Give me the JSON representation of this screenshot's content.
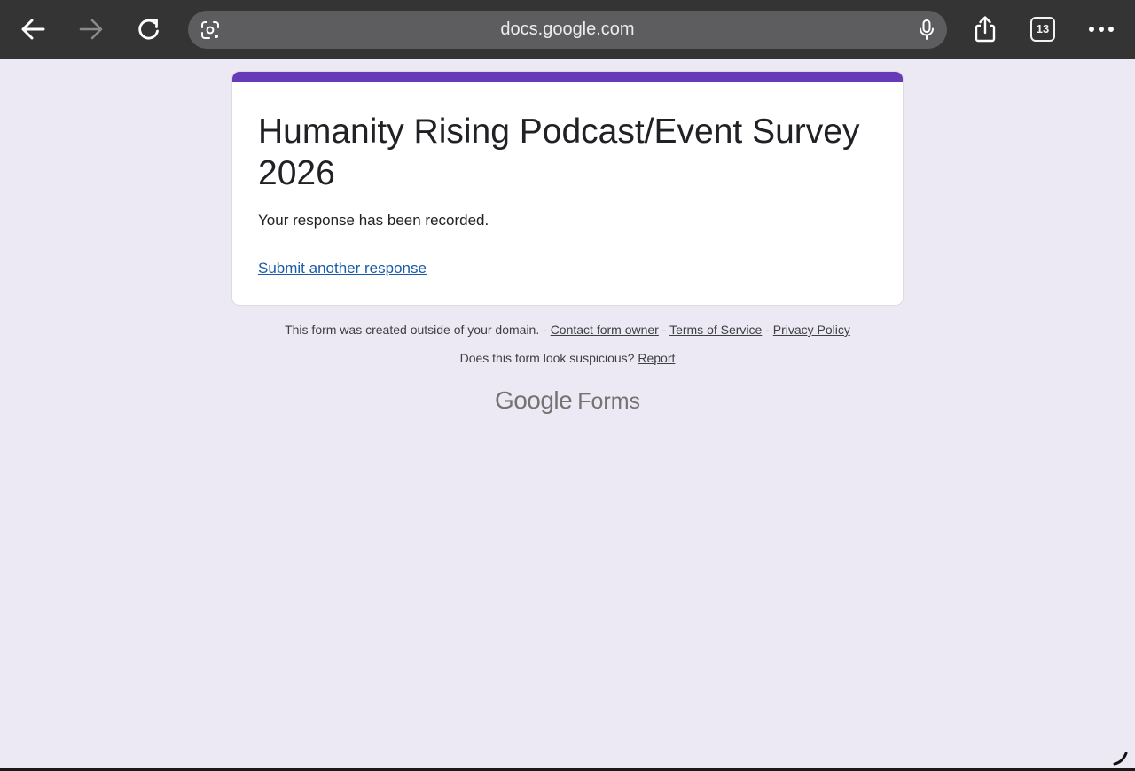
{
  "browser": {
    "url": "docs.google.com",
    "tab_count": "13",
    "icons": {
      "back": "arrow-left-icon",
      "forward": "arrow-right-icon",
      "reload": "reload-icon",
      "lens": "camera-search-icon",
      "mic": "microphone-icon",
      "share": "share-icon",
      "tabs": "tab-switcher-icon",
      "menu": "more-dots-icon"
    }
  },
  "form": {
    "title": "Humanity Rising Podcast/Event Survey 2026",
    "confirmation": "Your response has been recorded.",
    "submit_another": "Submit another response",
    "accent_color": "#673ab7"
  },
  "footer": {
    "domain_notice": "This form was created outside of your domain.",
    "separator": " - ",
    "contact_owner": "Contact form owner",
    "terms": "Terms of Service",
    "privacy": "Privacy Policy",
    "suspicious_question": "Does this form look suspicious?",
    "report": "Report",
    "logo_google": "Google",
    "logo_forms": "Forms"
  }
}
